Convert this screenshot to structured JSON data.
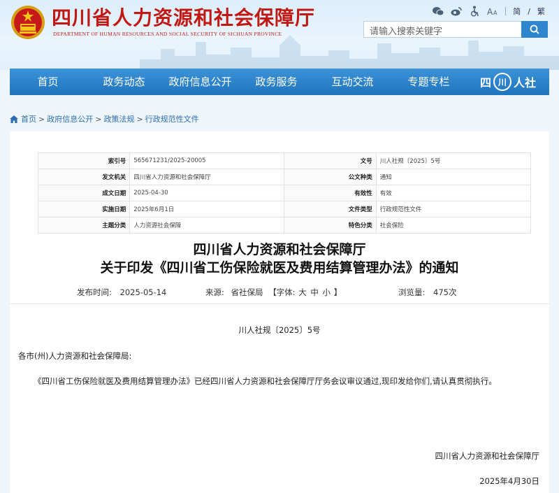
{
  "header": {
    "site_title": "四川省人力资源和社会保障厅",
    "site_subtitle": "DEPARTMENT OF HUMAN RESOURCES AND SOCIAL SECURITY OF SICHUAN PROVINCE",
    "lang_simplified": "简",
    "lang_traditional": "繁",
    "search_placeholder": "请输入搜索关键字",
    "tool_icons": [
      "wechat-icon",
      "weibo-icon",
      "accessibility-icon",
      "font-size-icon"
    ]
  },
  "nav": {
    "items": [
      "首页",
      "政务动态",
      "政府信息公开",
      "政务服务",
      "互动交流",
      "专题专栏"
    ],
    "logo_text_1": "四",
    "logo_text_2": "川",
    "logo_text_3": "人社"
  },
  "breadcrumb": {
    "items": [
      "首页",
      "政府信息公开",
      "政策法规",
      "行政规范性文件"
    ]
  },
  "meta": {
    "rows": [
      {
        "k1": "索引号",
        "v1": "565671231/2025-20005",
        "k2": "文号",
        "v2": "川人社规〔2025〕5号"
      },
      {
        "k1": "发文机关",
        "v1": "四川省人力资源和社会保障厅",
        "k2": "公文种类",
        "v2": "通知"
      },
      {
        "k1": "成文日期",
        "v1": "2025-04-30",
        "k2": "有效性",
        "v2": "有效"
      },
      {
        "k1": "实施日期",
        "v1": "2025年6月1日",
        "k2": "文件类型",
        "v2": "行政规范性文件"
      },
      {
        "k1": "主题分类",
        "v1": "人力资源社会保障",
        "k2": "特色分类",
        "v2": "社会保险"
      }
    ]
  },
  "article": {
    "title_line1": "四川省人力资源和社会保障厅",
    "title_line2": "关于印发《四川省工伤保险就医及费用结算管理办法》的通知",
    "publish_label": "发布时间:",
    "publish_date": "2025-05-14",
    "source_label": "来源:",
    "source": "省社保局",
    "font_label": "【字体:",
    "font_large": "大",
    "font_medium": "中",
    "font_small": "小",
    "font_close": "】",
    "views_label": "浏览量:",
    "views": "475次",
    "doc_number": "川人社规〔2025〕5号",
    "salutation": "各市(州)人力资源和社会保障局:",
    "body": "《四川省工伤保险就医及费用结算管理办法》已经四川省人力资源和社会保障厅厅务会议审议通过,现印发给你们,请认真贯彻执行。",
    "signature": "四川省人力资源和社会保障厅",
    "date": "2025年4月30日"
  },
  "colors": {
    "brand_red": "#c21812",
    "nav_blue": "#2a80c8",
    "link_blue": "#2d6fb1"
  }
}
